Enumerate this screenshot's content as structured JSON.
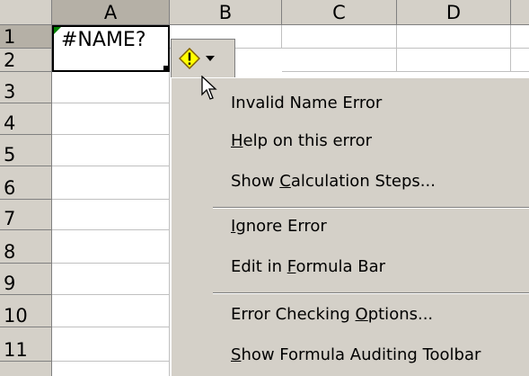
{
  "columns": [
    "A",
    "B",
    "C",
    "D"
  ],
  "rows": [
    "1",
    "2",
    "3",
    "4",
    "5",
    "6",
    "7",
    "8",
    "9",
    "10",
    "11"
  ],
  "active_cell": {
    "value": "#NAME?"
  },
  "smart_tag": {
    "icon": "warning-diamond-icon",
    "dropdown": "chevron-down-icon"
  },
  "context_menu": {
    "title": "Invalid Name Error",
    "items": [
      {
        "label": "Help on this error",
        "mnemonic": "H"
      },
      {
        "label": "Show Calculation Steps...",
        "mnemonic": "C"
      },
      {
        "label": "Ignore Error",
        "mnemonic": "I"
      },
      {
        "label": "Edit in Formula Bar",
        "mnemonic": "F"
      },
      {
        "label": "Error Checking Options...",
        "mnemonic": "O"
      },
      {
        "label": "Show Formula Auditing Toolbar",
        "mnemonic": "S"
      }
    ]
  },
  "colors": {
    "header_bg": "#d4d0c8",
    "warning": "#ffff00",
    "error_indicator": "#008000"
  }
}
